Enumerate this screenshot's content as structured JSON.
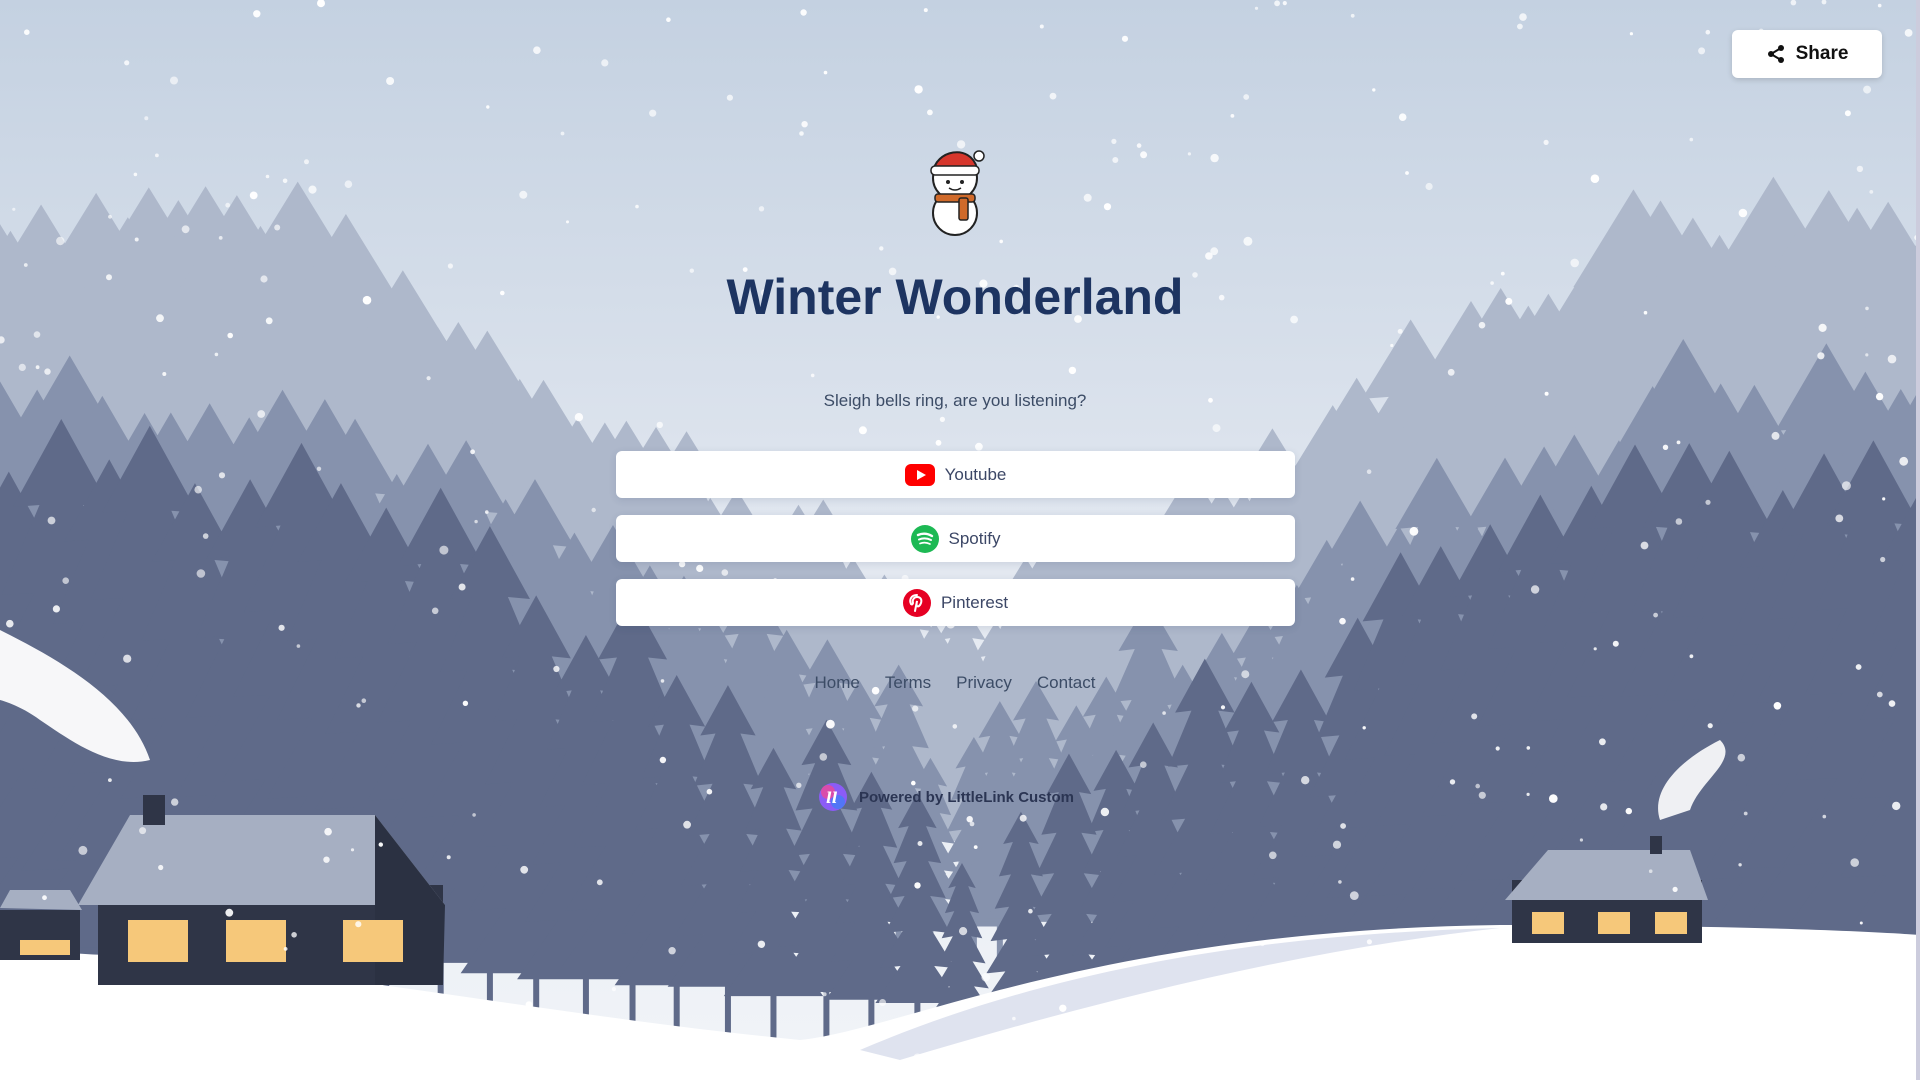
{
  "share": {
    "label": "Share",
    "icon": "share-icon"
  },
  "profile": {
    "avatar_icon": "snowman-icon",
    "title": "Winter Wonderland",
    "subtitle": "Sleigh bells ring, are you listening?"
  },
  "links": [
    {
      "label": "Youtube",
      "icon": "youtube-icon",
      "color": "#ff0000"
    },
    {
      "label": "Spotify",
      "icon": "spotify-icon",
      "color": "#1db954"
    },
    {
      "label": "Pinterest",
      "icon": "pinterest-icon",
      "color": "#e60023"
    }
  ],
  "footer": {
    "home": "Home",
    "terms": "Terms",
    "privacy": "Privacy",
    "contact": "Contact"
  },
  "powered": {
    "label": "Powered by LittleLink Custom",
    "icon": "littlelink-logo-icon"
  },
  "colors": {
    "title": "#1d3461",
    "sky_top": "#c5d2e2",
    "sky_bottom": "#edf1f6",
    "trees_far": "#aab4c8",
    "trees_mid": "#7e8aa6",
    "trees_near": "#5c6786"
  }
}
